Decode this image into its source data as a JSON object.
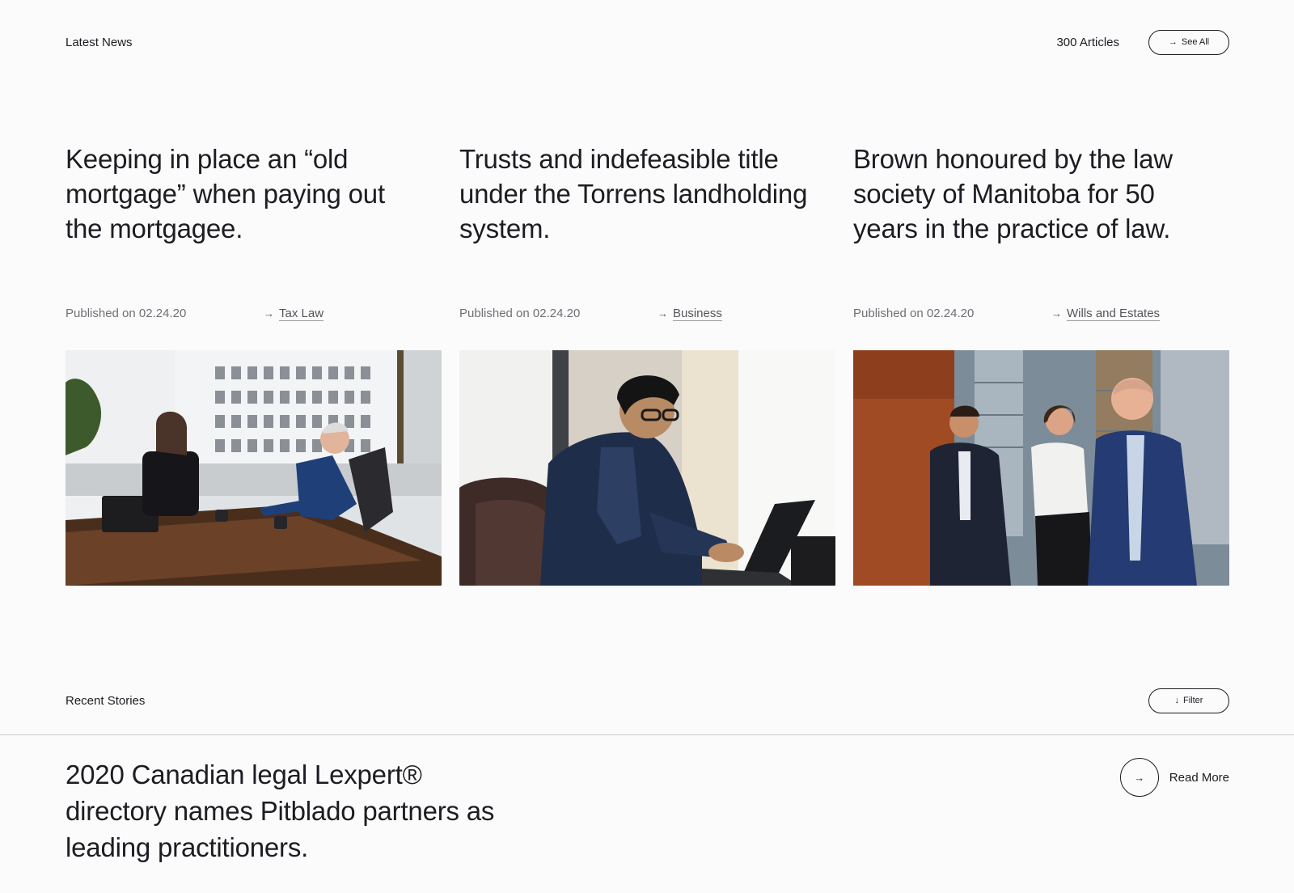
{
  "latest": {
    "label": "Latest News",
    "article_count": "300 Articles",
    "see_all": "See All",
    "arrow": "→"
  },
  "articles": [
    {
      "title": "Keeping in place an “old mortgage” when paying out the mortgagee.",
      "published": "Published on 02.24.20",
      "tag_arrow": "→",
      "tag": "Tax Law",
      "image_icon": "meeting-photo"
    },
    {
      "title": "Trusts and indefeasible title under the Torrens landholding system.",
      "published": "Published on 02.24.20",
      "tag_arrow": "→",
      "tag": "Business",
      "image_icon": "laptop-photo"
    },
    {
      "title": "Brown honoured by the law society of Manitoba for 50 years in the practice of law.",
      "published": "Published on 02.24.20",
      "tag_arrow": "→",
      "tag": "Wills and Estates",
      "image_icon": "team-photo"
    }
  ],
  "recent": {
    "label": "Recent Stories",
    "filter": "Filter",
    "filter_arrow": "↓"
  },
  "story": {
    "title": "2020 Canadian legal Lexpert® directory names Pitblado partners as leading practitioners.",
    "read_more": "Read More",
    "arrow": "→"
  },
  "colors": {
    "background": "#fbfbfb",
    "text": "#1c1c22",
    "muted": "#6f6f75",
    "divider": "#c8c8cc"
  }
}
